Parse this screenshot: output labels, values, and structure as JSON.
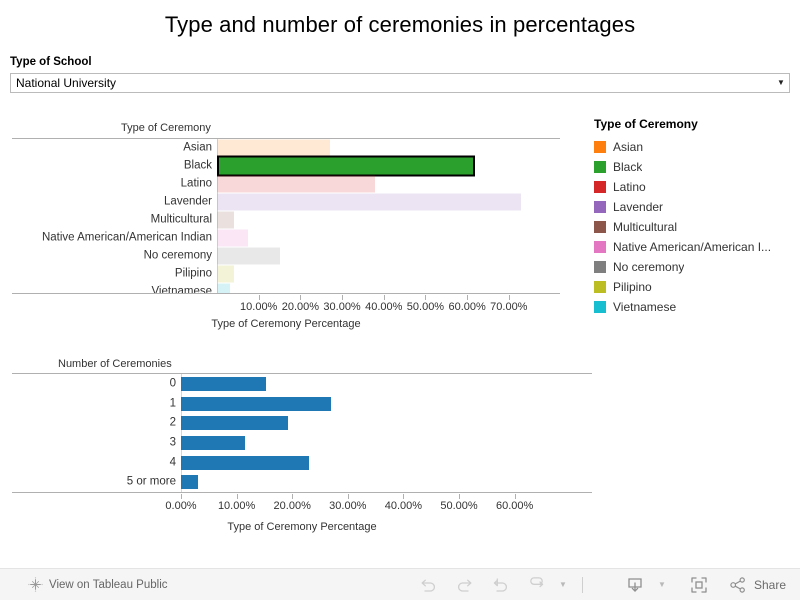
{
  "header": {
    "title": "Type and number of ceremonies in percentages"
  },
  "filter": {
    "label": "Type of School",
    "value": "National University",
    "caret": "▼"
  },
  "legend": {
    "title": "Type of Ceremony",
    "items": [
      {
        "label": "Asian",
        "color": "#ff7f0e"
      },
      {
        "label": "Black",
        "color": "#2ca02c"
      },
      {
        "label": "Latino",
        "color": "#d62728"
      },
      {
        "label": "Lavender",
        "color": "#9467bd"
      },
      {
        "label": "Multicultural",
        "color": "#8c564b"
      },
      {
        "label": "Native American/American I...",
        "color": "#e377c2"
      },
      {
        "label": "No ceremony",
        "color": "#7f7f7f"
      },
      {
        "label": "Pilipino",
        "color": "#bcbd22"
      },
      {
        "label": "Vietnamese",
        "color": "#17becf"
      }
    ]
  },
  "chart_data": [
    {
      "id": "ceremony-type-chart",
      "type": "bar",
      "orientation": "horizontal",
      "title": "",
      "corner_label": "Type of Ceremony",
      "xlabel": "Type of Ceremony Percentage",
      "ylabel": "Type of Ceremony",
      "xlim": [
        0,
        77
      ],
      "xticks": [
        10,
        20,
        30,
        40,
        50,
        60,
        70
      ],
      "xticklabels": [
        "10.00%",
        "20.00%",
        "30.00%",
        "40.00%",
        "50.00%",
        "60.00%",
        "70.00%"
      ],
      "grid": false,
      "legend_position": "right",
      "categories": [
        "Asian",
        "Black",
        "Latino",
        "Lavender",
        "Multicultural",
        "Native American/American Indian",
        "No ceremony",
        "Pilipino",
        "Vietnamese"
      ],
      "values": [
        27.0,
        61.8,
        38.0,
        73.0,
        4.0,
        7.5,
        15.2,
        4.0,
        3.0
      ],
      "colors": [
        "#ff7f0e",
        "#2ca02c",
        "#d62728",
        "#9467bd",
        "#8c564b",
        "#e377c2",
        "#7f7f7f",
        "#bcbd22",
        "#17becf"
      ],
      "highlighted": "Black",
      "note": "Non-highlighted bars drawn at ~18% opacity; highlighted bar full opacity with black outline"
    },
    {
      "id": "number-of-ceremonies-chart",
      "type": "bar",
      "orientation": "horizontal",
      "title": "",
      "corner_label": "Number of Ceremonies",
      "xlabel": "Type of Ceremony Percentage",
      "ylabel": "Number of Ceremonies",
      "xlim": [
        0,
        66
      ],
      "xticks": [
        0,
        10,
        20,
        30,
        40,
        50,
        60
      ],
      "xticklabels": [
        "0.00%",
        "10.00%",
        "20.00%",
        "30.00%",
        "40.00%",
        "50.00%",
        "60.00%"
      ],
      "grid": false,
      "legend_position": "none",
      "categories": [
        "0",
        "1",
        "2",
        "3",
        "4",
        "5 or more"
      ],
      "values": [
        15.2,
        27.0,
        19.2,
        11.5,
        23.0,
        3.0
      ],
      "bar_color": "#1f77b4"
    }
  ],
  "toolbar": {
    "view_on_tableau": "View on Tableau Public",
    "undo": "Undo",
    "redo": "Redo",
    "revert": "Revert",
    "refresh": "Refresh",
    "refresh_caret": "▼",
    "download": "Download",
    "download_caret": "▼",
    "fullscreen": "Full Screen",
    "share": "Share"
  }
}
